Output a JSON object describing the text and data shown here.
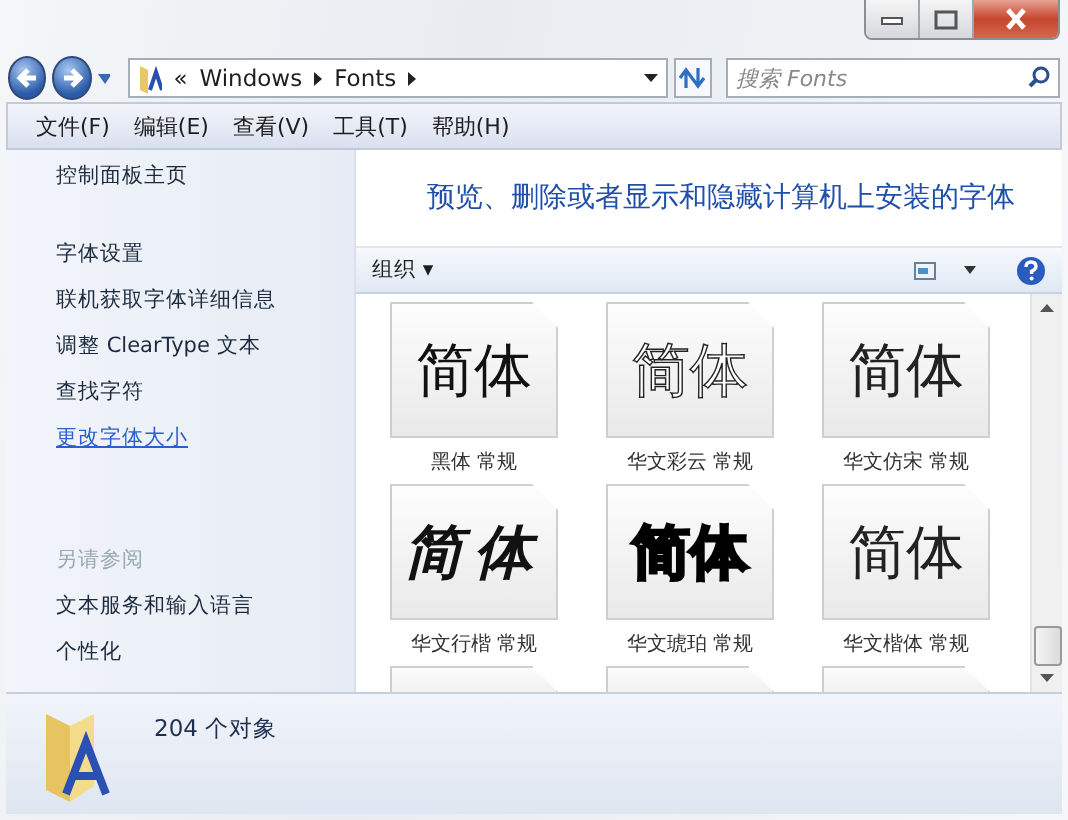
{
  "address": {
    "separator": "«",
    "crumbs": [
      "Windows",
      "Fonts"
    ]
  },
  "search": {
    "placeholder": "搜索 Fonts"
  },
  "menu": [
    "文件(F)",
    "编辑(E)",
    "查看(V)",
    "工具(T)",
    "帮助(H)"
  ],
  "sidebar": {
    "home": "控制面板主页",
    "items": [
      {
        "label": "字体设置",
        "hovered": false
      },
      {
        "label": "联机获取字体详细信息",
        "hovered": false
      },
      {
        "label": "调整 ClearType 文本",
        "hovered": false
      },
      {
        "label": "查找字符",
        "hovered": false
      },
      {
        "label": "更改字体大小",
        "hovered": true
      }
    ],
    "see_also": {
      "heading": "另请参阅",
      "items": [
        "文本服务和输入语言",
        "个性化"
      ]
    }
  },
  "heading": "预览、删除或者显示和隐藏计算机上安装的字体",
  "toolbar": {
    "organize": "组织 ▾"
  },
  "fonts": [
    {
      "kind": "sans",
      "sample": "简体",
      "label": "黑体 常规"
    },
    {
      "kind": "outline",
      "sample": "简体",
      "label": "华文彩云 常规"
    },
    {
      "kind": "serif",
      "sample": "简体",
      "label": "华文仿宋 常规"
    },
    {
      "kind": "brush",
      "sample": "简体",
      "label": "华文行楷 常规"
    },
    {
      "kind": "heavy",
      "sample": "简体",
      "label": "华文琥珀 常规"
    },
    {
      "kind": "serif",
      "sample": "简体",
      "label": "华文楷体 常规"
    },
    {
      "kind": "cut"
    },
    {
      "kind": "cut"
    },
    {
      "kind": "cut"
    }
  ],
  "status": {
    "count": "204 个对象"
  }
}
